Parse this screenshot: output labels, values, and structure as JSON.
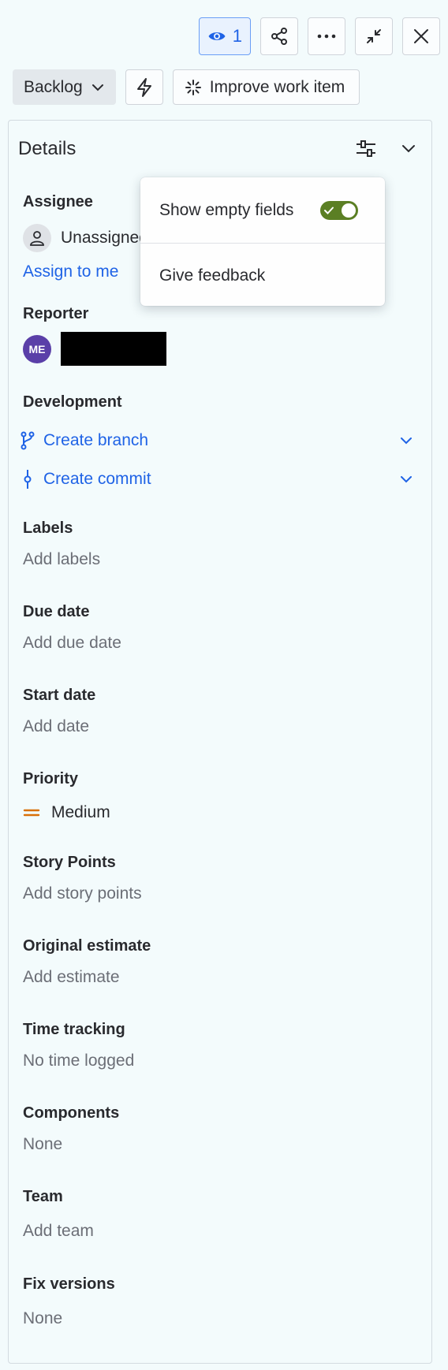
{
  "header": {
    "watch_count": "1",
    "status": "Backlog",
    "improve_label": "Improve work item"
  },
  "details": {
    "title": "Details"
  },
  "popup": {
    "show_empty_fields": "Show empty fields",
    "give_feedback": "Give feedback",
    "toggle_on": true
  },
  "fields": {
    "assignee": {
      "label": "Assignee",
      "value": "Unassigned",
      "link": "Assign to me"
    },
    "reporter": {
      "label": "Reporter",
      "avatar_initials": "ME"
    },
    "development": {
      "label": "Development",
      "create_branch": "Create branch",
      "create_commit": "Create commit"
    },
    "labels": {
      "label": "Labels",
      "value": "Add labels"
    },
    "due_date": {
      "label": "Due date",
      "value": "Add due date"
    },
    "start_date": {
      "label": "Start date",
      "value": "Add date"
    },
    "priority": {
      "label": "Priority",
      "value": "Medium"
    },
    "story_points": {
      "label": "Story Points",
      "value": "Add story points"
    },
    "original_estimate": {
      "label": "Original estimate",
      "value": "Add estimate"
    },
    "time_tracking": {
      "label": "Time tracking",
      "value": "No time logged"
    },
    "components": {
      "label": "Components",
      "value": "None"
    },
    "team": {
      "label": "Team",
      "value": "Add team"
    },
    "fix_versions": {
      "label": "Fix versions",
      "value": "None"
    }
  },
  "colors": {
    "accent": "#1f63e6",
    "toggle": "#5b7f24",
    "priority_medium": "#d97008",
    "avatar": "#5a3fa8"
  },
  "icons": [
    "eye-icon",
    "share-icon",
    "more-icon",
    "minimize-icon",
    "close-icon",
    "chevron-down-icon",
    "bolt-icon",
    "sparkle-icon",
    "settings-sliders-icon",
    "user-icon",
    "branch-icon",
    "commit-icon",
    "priority-medium-icon",
    "check-icon"
  ]
}
